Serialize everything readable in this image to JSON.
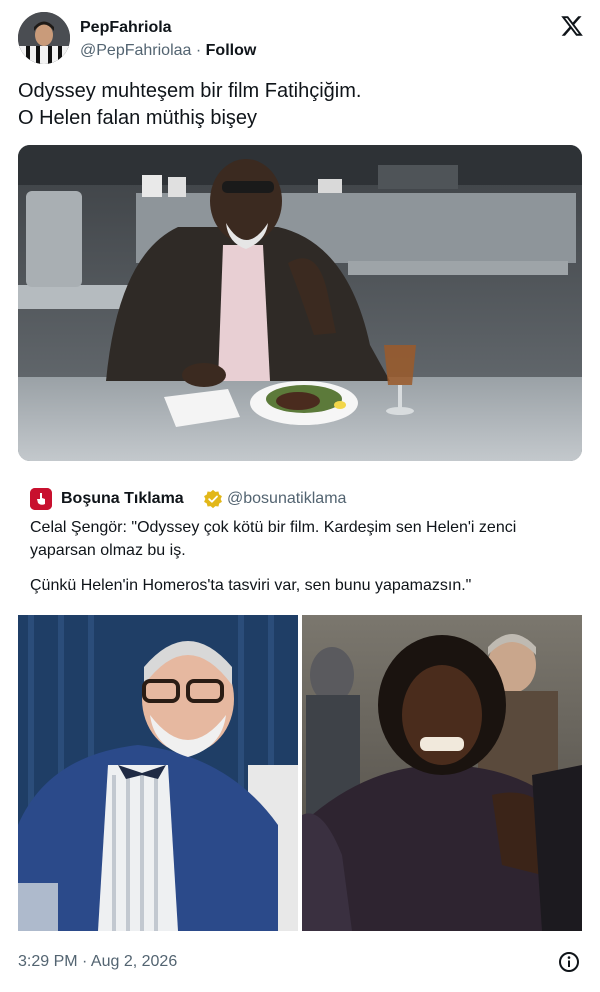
{
  "author": {
    "display_name": "PepFahriola",
    "handle": "@PepFahriolaa",
    "separator": "·",
    "follow_label": "Follow"
  },
  "tweet": {
    "lines": [
      "Odyssey muhteşem bir film Fatihçiğim.",
      "O Helen falan müthiş bişey"
    ]
  },
  "quoted_tweet": {
    "display_name": "Boşuna Tıklama",
    "handle": "@bosunatiklama",
    "paragraphs": [
      [
        "Celal Şengör: \"Odyssey çok kötü bir film. Kardeşim sen Helen'i zenci",
        "yaparsan olmaz bu iş."
      ],
      [
        "Çünkü Helen'in Homeros'ta tasviri var, sen bunu yapamazsın.\""
      ]
    ]
  },
  "footer": {
    "timestamp": "3:29 PM · Aug 2, 2026"
  },
  "icons": {
    "brand": "x-logo-icon",
    "verified": "verified-badge-icon",
    "info": "info-icon",
    "quoted_avatar": "pointer-hand-icon"
  },
  "colors": {
    "text_primary": "#0f1419",
    "text_secondary": "#536471",
    "verified_gold": "#e2b719",
    "quoted_avatar_red": "#c8102e"
  }
}
